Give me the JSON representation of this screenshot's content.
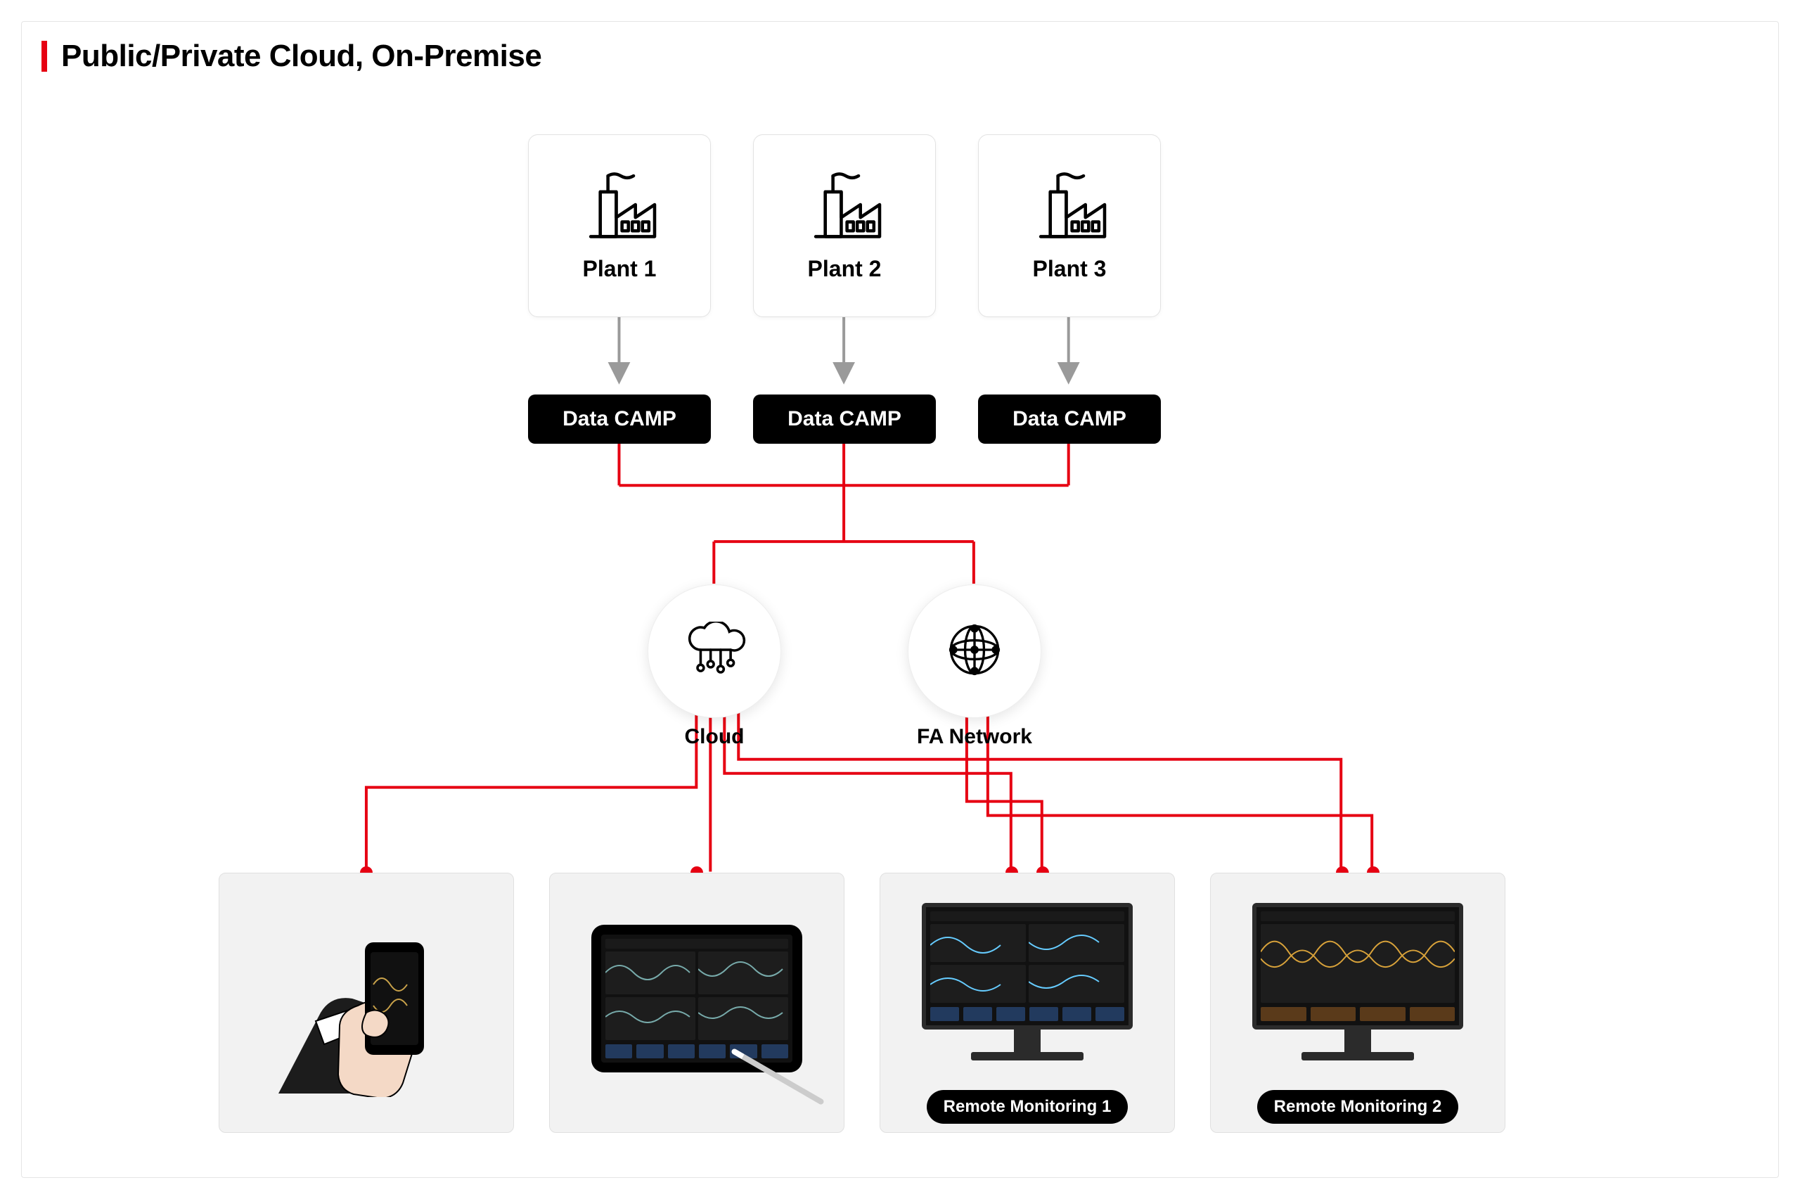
{
  "title": "Public/Private Cloud, On-Premise",
  "colors": {
    "accent": "#e60012",
    "node_dark": "#000000"
  },
  "plants": [
    {
      "label": "Plant 1"
    },
    {
      "label": "Plant 2"
    },
    {
      "label": "Plant 3"
    }
  ],
  "data_camp_label": "Data CAMP",
  "network_nodes": [
    {
      "id": "cloud",
      "label": "Cloud"
    },
    {
      "id": "fa",
      "label": "FA Network"
    }
  ],
  "devices": [
    {
      "id": "phone",
      "badge": null,
      "connects": [
        "cloud"
      ]
    },
    {
      "id": "tablet",
      "badge": null,
      "connects": [
        "cloud"
      ]
    },
    {
      "id": "mon1",
      "badge": "Remote Monitoring 1",
      "connects": [
        "cloud",
        "fa"
      ]
    },
    {
      "id": "mon2",
      "badge": "Remote Monitoring 2",
      "connects": [
        "cloud",
        "fa"
      ]
    }
  ]
}
